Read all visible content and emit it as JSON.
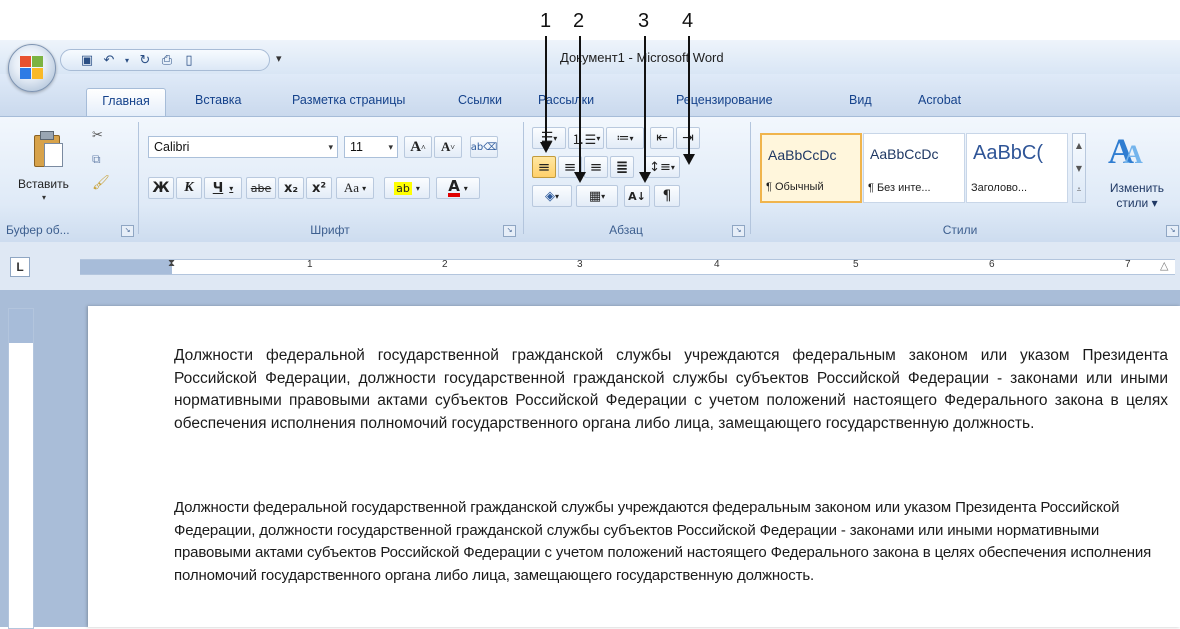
{
  "annotations": [
    "1",
    "2",
    "3",
    "4"
  ],
  "title": "Документ1 - Microsoft Word",
  "tabs": [
    "Главная",
    "Вставка",
    "Разметка страницы",
    "Ссылки",
    "Рассылки",
    "Рецензирование",
    "Вид",
    "Acrobat"
  ],
  "clipboard": {
    "paste_label": "Вставить",
    "group_label": "Буфер об..."
  },
  "font": {
    "name": "Calibri",
    "size": "11",
    "group_label": "Шрифт",
    "bold": "Ж",
    "italic": "К",
    "underline": "Ч",
    "strike": "abe",
    "subscript": "x₂",
    "superscript": "x²",
    "case": "Aa",
    "highlight": "ab",
    "color": "A"
  },
  "paragraph": {
    "group_label": "Абзац",
    "pilcrow": "¶"
  },
  "styles": {
    "items": [
      {
        "sample": "AaBbCcDc",
        "name": "¶ Обычный"
      },
      {
        "sample": "AaBbCcDc",
        "name": "¶ Без инте..."
      },
      {
        "sample": "AaBbC(",
        "name": "Заголово..."
      }
    ],
    "change_label_1": "Изменить",
    "change_label_2": "стили",
    "group_label": "Стили"
  },
  "ruler": {
    "corner": "L",
    "numbers": [
      "1",
      "2",
      "3",
      "4",
      "5",
      "6",
      "7"
    ]
  },
  "document": {
    "paragraph_1": "Должности федеральной государственной гражданской службы учреждаются федеральным законом или указом Президента Российской Федерации, должности государственной гражданской службы субъектов Российской Федерации - законами или иными нормативными правовыми актами субъектов Российской Федерации с учетом положений настоящего Федерального закона в целях обеспечения исполнения полномочий государственного органа либо лица, замещающего государственную должность.",
    "paragraph_2": "Должности федеральной государственной гражданской службы учреждаются федеральным законом или указом Президента Российской Федерации, должности государственной гражданской службы субъектов Российской Федерации - законами или иными нормативными правовыми актами субъектов Российской Федерации с учетом положений настоящего Федерального закона в целях обеспечения исполнения полномочий государственного органа либо лица, замещающего государственную должность."
  },
  "colors": {
    "ribbon": "#dfeaf7",
    "tab_text": "#15428b",
    "selected_button": "#ffd06a"
  }
}
